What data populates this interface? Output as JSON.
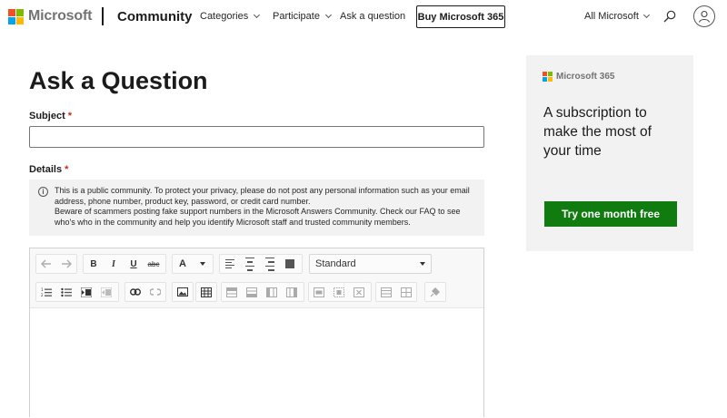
{
  "header": {
    "logo_text": "Microsoft",
    "brand": "Community",
    "nav": [
      {
        "label": "Categories",
        "has_chevron": true
      },
      {
        "label": "Participate",
        "has_chevron": true
      },
      {
        "label": "Ask a question",
        "has_chevron": false
      }
    ],
    "buy_button": "Buy Microsoft 365",
    "all_microsoft": "All Microsoft",
    "icons": {
      "search": "search-icon",
      "account": "account-icon"
    }
  },
  "page": {
    "title": "Ask a Question",
    "subject_label": "Subject",
    "subject_value": "",
    "details_label": "Details",
    "required_mark": "*",
    "notice_line1": "This is a public community. To protect your privacy, please do not post any personal information such as your email address, phone number, product key, password, or credit card number.",
    "notice_line2": "Beware of scammers posting fake support numbers in the Microsoft Answers Community.  Check our FAQ to see who's who in the community and help you identify Microsoft staff and trusted community members."
  },
  "editor": {
    "format_select": "Standard",
    "toolbar_row1": [
      "undo",
      "redo",
      "bold",
      "italic",
      "underline",
      "strikethrough",
      "font-color",
      "font-color-dropdown",
      "align-left",
      "align-center",
      "align-right",
      "justify"
    ],
    "toolbar_row2": [
      "numbered-list",
      "bulleted-list",
      "indent",
      "outdent",
      "link",
      "unlink",
      "image",
      "table",
      "table-row-above",
      "table-row-below",
      "table-col-left",
      "table-col-right",
      "merge-cells",
      "split-cells",
      "delete-cells",
      "table-props-1",
      "table-props-2",
      "clear-formatting"
    ],
    "labels": {
      "bold": "B",
      "italic": "I",
      "underline": "U",
      "strike": "abc",
      "font_color": "A"
    }
  },
  "ad": {
    "logo_text": "Microsoft 365",
    "headline": "A subscription to make the most of your time",
    "button": "Try one month free",
    "button_color": "#107c10"
  },
  "colors": {
    "ms_red": "#f25022",
    "ms_green": "#7fba00",
    "ms_blue": "#00a4ef",
    "ms_yellow": "#ffb900",
    "required": "#c42b1c"
  }
}
